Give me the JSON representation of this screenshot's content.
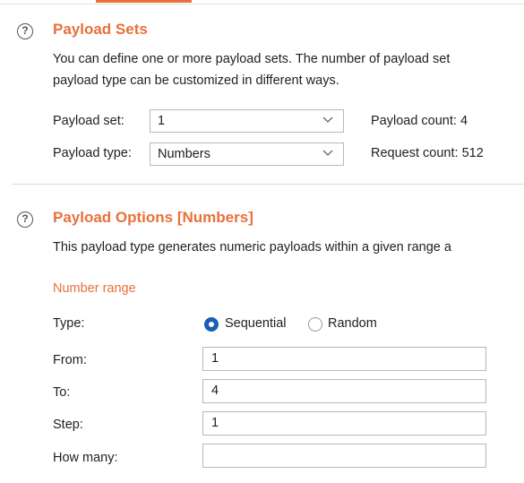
{
  "payload_sets": {
    "title": "Payload Sets",
    "description_line1": "You can define one or more payload sets. The number of payload set",
    "description_line2": "payload type can be customized in different ways.",
    "payload_set_label": "Payload set:",
    "payload_set_value": "1",
    "payload_type_label": "Payload type:",
    "payload_type_value": "Numbers",
    "payload_count": "Payload count: 4",
    "request_count": "Request count: 512"
  },
  "payload_options": {
    "title": "Payload Options [Numbers]",
    "description": "This payload type generates numeric payloads within a given range a",
    "number_range_heading": "Number range",
    "type_label": "Type:",
    "type_options": [
      "Sequential",
      "Random"
    ],
    "type_selected": "Sequential",
    "from_label": "From:",
    "from_value": "1",
    "to_label": "To:",
    "to_value": "4",
    "step_label": "Step:",
    "step_value": "1",
    "how_many_label": "How many:",
    "how_many_value": ""
  },
  "icons": {
    "help": "?"
  },
  "colors": {
    "accent": "#e8703a",
    "radio_selected": "#1a5fb4"
  }
}
